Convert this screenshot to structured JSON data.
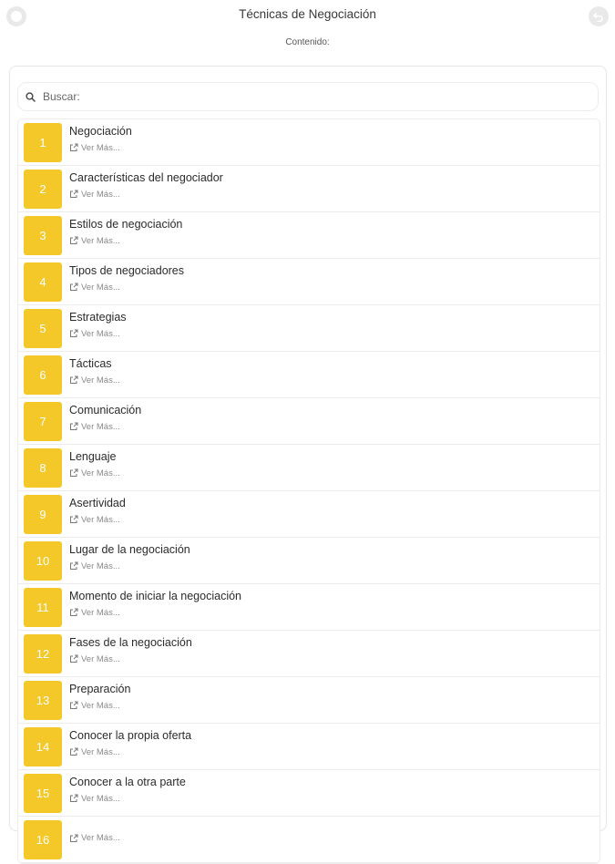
{
  "header": {
    "title": "Técnicas de Negociación",
    "subtitle": "Contenido:"
  },
  "search": {
    "placeholder": "Buscar:"
  },
  "list": {
    "more_label": "Ver Más...",
    "items": [
      {
        "number": "1",
        "label": "Negociación"
      },
      {
        "number": "2",
        "label": "Características del negociador"
      },
      {
        "number": "3",
        "label": "Estilos de negociación"
      },
      {
        "number": "4",
        "label": "Tipos de negociadores"
      },
      {
        "number": "5",
        "label": "Estrategias"
      },
      {
        "number": "6",
        "label": "Tácticas"
      },
      {
        "number": "7",
        "label": "Comunicación"
      },
      {
        "number": "8",
        "label": "Lenguaje"
      },
      {
        "number": "9",
        "label": "Asertividad"
      },
      {
        "number": "10",
        "label": "Lugar de la negociación"
      },
      {
        "number": "11",
        "label": "Momento de iniciar la negociación"
      },
      {
        "number": "12",
        "label": "Fases de la negociación"
      },
      {
        "number": "13",
        "label": "Preparación"
      },
      {
        "number": "14",
        "label": "Conocer la propia oferta"
      },
      {
        "number": "15",
        "label": "Conocer a la otra parte"
      },
      {
        "number": "16",
        "label": ""
      }
    ]
  },
  "colors": {
    "accent": "#f5c82a",
    "button_bg": "#e9e9ea"
  },
  "icons": {
    "left": "menu-icon",
    "right": "back-icon",
    "search": "search-icon",
    "more": "external-link-icon"
  }
}
